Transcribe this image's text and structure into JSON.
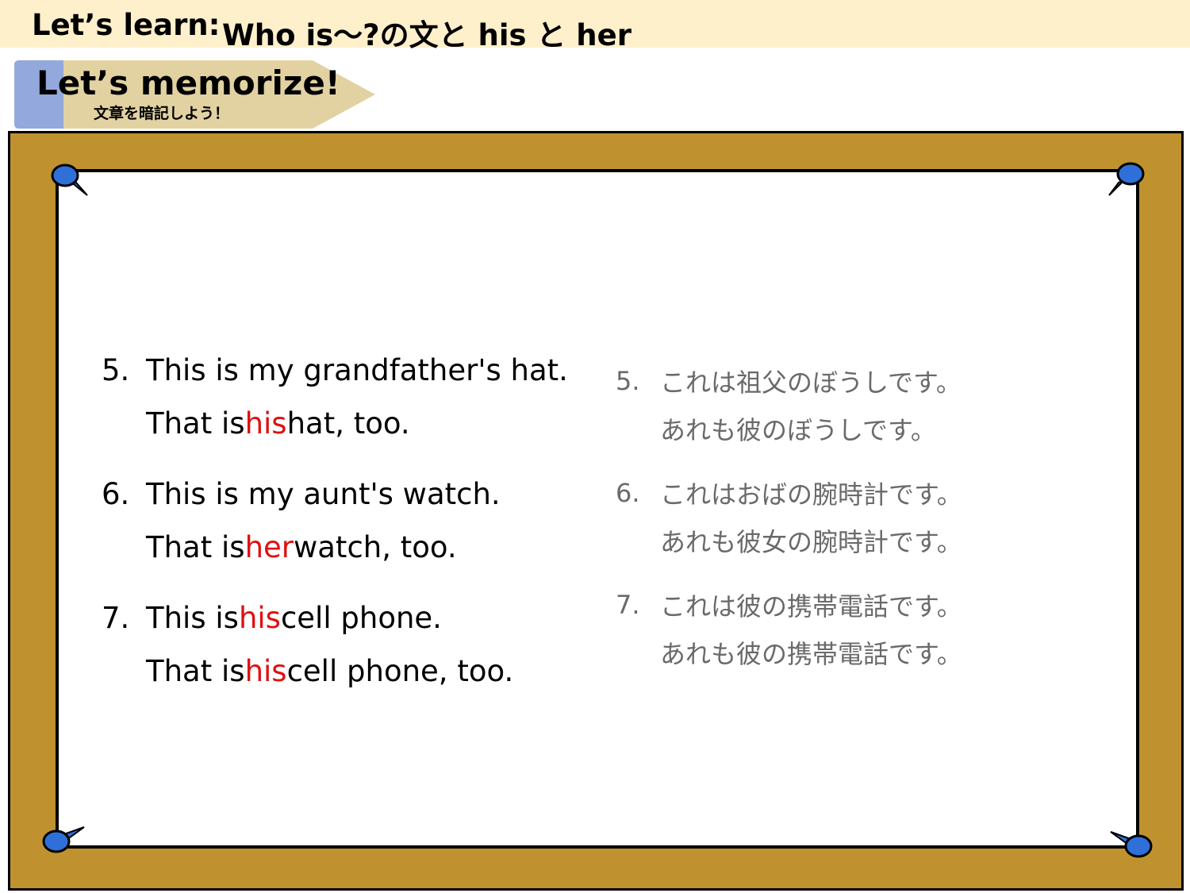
{
  "header": {
    "prefix": "Let’s learn:",
    "title": "Who is〜?の文と his と her",
    "background": "#fff0cc"
  },
  "tag": {
    "title": "Let’s memorize!",
    "subtitle": "文章を暗記しよう！",
    "accent_color": "#93a8dc",
    "body_color": "#e2d2a2"
  },
  "board": {
    "frame_color": "#bf922f",
    "pin_color": "#2f6fd8",
    "pin_icon": "push-pin-icon"
  },
  "highlight_color": "#e01010",
  "english": [
    {
      "num": "5.",
      "line1": {
        "a": "This is my grandfather's hat.",
        "hl": "",
        "b": ""
      },
      "line2": {
        "a": "That is ",
        "hl": "his",
        "b": " hat, too."
      }
    },
    {
      "num": "6.",
      "line1": {
        "a": "This is my aunt's watch.",
        "hl": "",
        "b": ""
      },
      "line2": {
        "a": "That is ",
        "hl": "her",
        "b": " watch, too."
      }
    },
    {
      "num": "7.",
      "line1": {
        "a": "This is ",
        "hl": "his",
        "b": " cell phone."
      },
      "line2": {
        "a": "That is ",
        "hl": "his",
        "b": " cell phone, too."
      }
    }
  ],
  "japanese": [
    {
      "num": "5.",
      "line1": "これは祖父のぼうしです。",
      "line2": "あれも彼のぼうしです。"
    },
    {
      "num": "6.",
      "line1": "これはおばの腕時計です。",
      "line2": "あれも彼女の腕時計です。"
    },
    {
      "num": "7.",
      "line1": "これは彼の携帯電話です。",
      "line2": "あれも彼の携帯電話です。"
    }
  ]
}
